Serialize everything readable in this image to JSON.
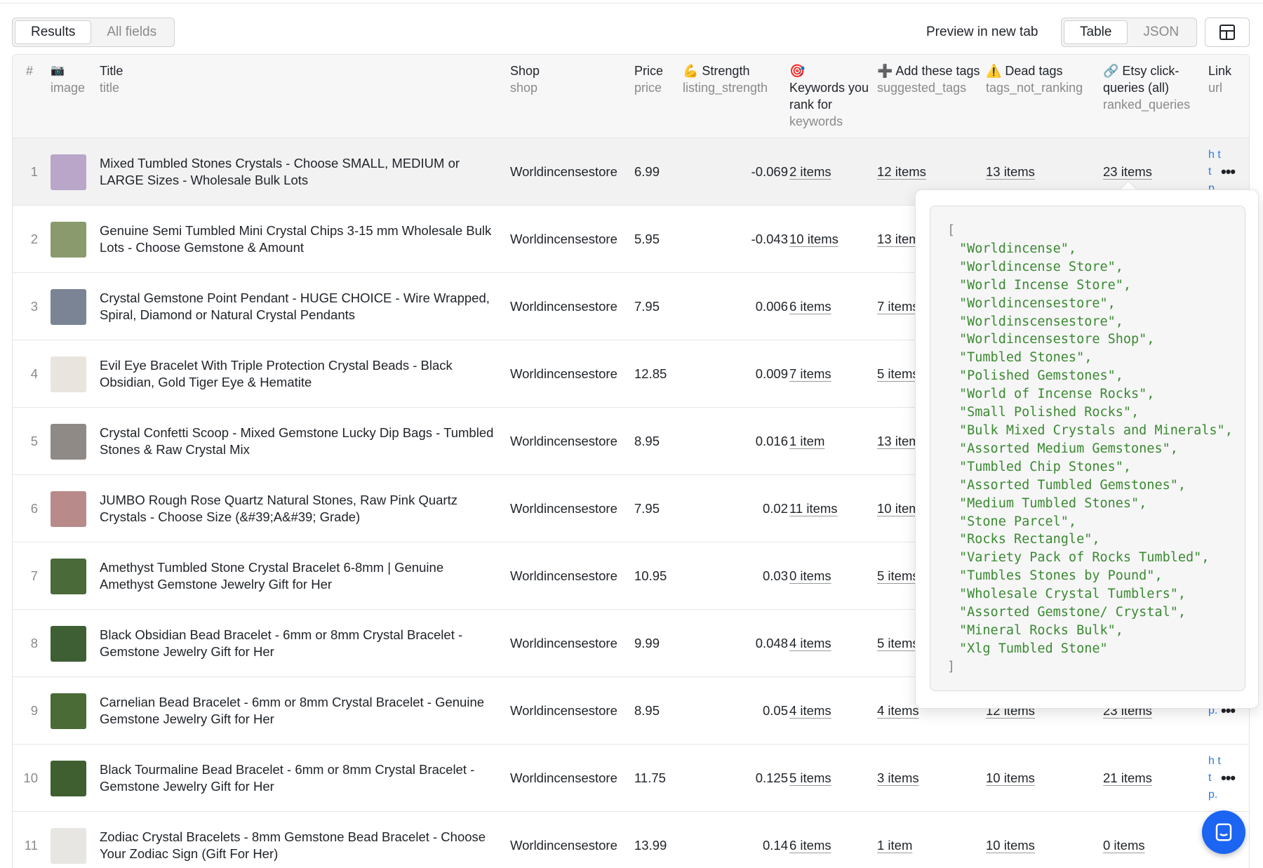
{
  "toolbar": {
    "results_label": "Results",
    "all_fields_label": "All fields",
    "preview_label": "Preview in new tab",
    "table_label": "Table",
    "json_label": "JSON"
  },
  "header": {
    "num": "#",
    "image_icon": "📷",
    "image_key": "image",
    "title": "Title",
    "title_key": "title",
    "shop": "Shop",
    "shop_key": "shop",
    "price": "Price",
    "price_key": "price",
    "strength": "💪 Strength",
    "strength_key": "listing_strength",
    "keywords_icon": "🎯",
    "keywords": "Keywords you rank for",
    "keywords_key": "keywords",
    "add_tags": "➕ Add these tags",
    "add_tags_key": "suggested_tags",
    "dead_tags": "⚠️ Dead tags",
    "dead_tags_key": "tags_not_ranking",
    "etsy": "🔗 Etsy click-queries (all)",
    "etsy_key": "ranked_queries",
    "link": "Link",
    "link_key": "url"
  },
  "rows": [
    {
      "n": "1",
      "title": "Mixed Tumbled Stones Crystals - Choose SMALL, MEDIUM or LARGE Sizes - Wholesale Bulk Lots",
      "shop": "Worldincensestore",
      "price": "6.99",
      "strength": "-0.069",
      "kw": "2 items",
      "add": "12 items",
      "dead": "13 items",
      "ranked": "23 items",
      "link": "h tt p.",
      "thumb": "#b9a6c8"
    },
    {
      "n": "2",
      "title": "Genuine Semi Tumbled Mini Crystal Chips 3-15 mm Wholesale Bulk Lots - Choose Gemstone & Amount",
      "shop": "Worldincensestore",
      "price": "5.95",
      "strength": "-0.043",
      "kw": "10 items",
      "add": "13 items",
      "dead": "",
      "ranked": "",
      "link": "",
      "thumb": "#8a9a6c"
    },
    {
      "n": "3",
      "title": "Crystal Gemstone Point Pendant - HUGE CHOICE - Wire Wrapped, Spiral, Diamond or Natural Crystal Pendants",
      "shop": "Worldincensestore",
      "price": "7.95",
      "strength": "0.006",
      "kw": "6 items",
      "add": "7 items",
      "dead": "",
      "ranked": "",
      "link": "",
      "thumb": "#7a8494"
    },
    {
      "n": "4",
      "title": "Evil Eye Bracelet With Triple Protection Crystal Beads - Black Obsidian, Gold Tiger Eye & Hematite",
      "shop": "Worldincensestore",
      "price": "12.85",
      "strength": "0.009",
      "kw": "7 items",
      "add": "5 items",
      "dead": "",
      "ranked": "",
      "link": "",
      "thumb": "#e9e4de"
    },
    {
      "n": "5",
      "title": "Crystal Confetti Scoop - Mixed Gemstone Lucky Dip Bags - Tumbled Stones & Raw Crystal Mix",
      "shop": "Worldincensestore",
      "price": "8.95",
      "strength": "0.016",
      "kw": "1 item",
      "add": "13 items",
      "dead": "",
      "ranked": "",
      "link": "",
      "thumb": "#8f8a86"
    },
    {
      "n": "6",
      "title": "JUMBO Rough Rose Quartz Natural Stones, Raw Pink Quartz Crystals - Choose Size (&#39;A&#39; Grade)",
      "shop": "Worldincensestore",
      "price": "7.95",
      "strength": "0.02",
      "kw": "11 items",
      "add": "10 items",
      "dead": "",
      "ranked": "",
      "link": "",
      "thumb": "#b88a8a"
    },
    {
      "n": "7",
      "title": "Amethyst Tumbled Stone Crystal Bracelet 6-8mm | Genuine Amethyst Gemstone Jewelry Gift for Her",
      "shop": "Worldincensestore",
      "price": "10.95",
      "strength": "0.03",
      "kw": "0 items",
      "add": "5 items",
      "dead": "",
      "ranked": "",
      "link": "",
      "thumb": "#4a6a3a"
    },
    {
      "n": "8",
      "title": "Black Obsidian Bead Bracelet - 6mm or 8mm Crystal Bracelet - Gemstone Jewelry Gift for Her",
      "shop": "Worldincensestore",
      "price": "9.99",
      "strength": "0.048",
      "kw": "4 items",
      "add": "5 items",
      "dead": "",
      "ranked": "",
      "link": "",
      "thumb": "#3e5e34"
    },
    {
      "n": "9",
      "title": "Carnelian Bead Bracelet - 6mm or 8mm Crystal Bracelet - Genuine Gemstone Jewelry Gift for Her",
      "shop": "Worldincensestore",
      "price": "8.95",
      "strength": "0.05",
      "kw": "4 items",
      "add": "4 items",
      "dead": "12 items",
      "ranked": "23 items",
      "link": "tt p.",
      "thumb": "#4a6a36"
    },
    {
      "n": "10",
      "title": "Black Tourmaline Bead Bracelet - 6mm or 8mm Crystal Bracelet - Gemstone Jewelry Gift for Her",
      "shop": "Worldincensestore",
      "price": "11.75",
      "strength": "0.125",
      "kw": "5 items",
      "add": "3 items",
      "dead": "10 items",
      "ranked": "21 items",
      "link": "h tt p.",
      "thumb": "#3f5f30"
    },
    {
      "n": "11",
      "title": "Zodiac Crystal Bracelets - 8mm Gemstone Bead Bracelet - Choose Your Zodiac Sign (Gift For Her)",
      "shop": "Worldincensestore",
      "price": "13.99",
      "strength": "0.14",
      "kw": "6 items",
      "add": "1 item",
      "dead": "10 items",
      "ranked": "0 items",
      "link": "p.",
      "thumb": "#e8e6e2"
    }
  ],
  "popover": {
    "open": "[",
    "close": "]",
    "lines": [
      "\"Worldincense\",",
      "\"Worldincense Store\",",
      "\"World Incense Store\",",
      "\"Worldincensestore\",",
      "\"Worldinscensestore\",",
      "\"Worldincensestore Shop\",",
      "\"Tumbled Stones\",",
      "\"Polished Gemstones\",",
      "\"World of Incense Rocks\",",
      "\"Small Polished Rocks\",",
      "\"Bulk Mixed Crystals and Minerals\",",
      "\"Assorted Medium Gemstones\",",
      "\"Tumbled Chip Stones\",",
      "\"Assorted Tumbled Gemstones\",",
      "\"Medium Tumbled Stones\",",
      "\"Stone Parcel\",",
      "\"Rocks Rectangle\",",
      "\"Variety Pack of Rocks Tumbled\",",
      "\"Tumbles Stones by Pound\",",
      "\"Wholesale Crystal Tumblers\",",
      "\"Assorted Gemstone/ Crystal\",",
      "\"Mineral Rocks Bulk\",",
      "\"Xlg Tumbled Stone\""
    ]
  },
  "colors": {
    "accent": "#1c64f2",
    "json_string": "#3a8a30",
    "link": "#2f7bd9"
  }
}
